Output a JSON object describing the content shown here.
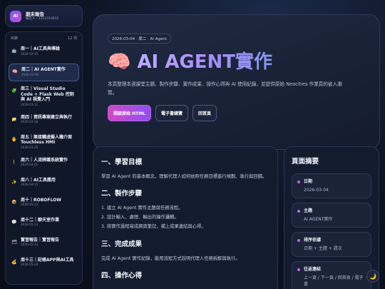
{
  "profile": {
    "avatar": "AI",
    "title": "期末報告",
    "subtitle": "報告人 · 1111310012"
  },
  "toc": {
    "label": "目錄",
    "count": "12 項",
    "items": [
      {
        "icon": "🤖",
        "title": "周一｜AI工具與導論",
        "date": "2026-02-25"
      },
      {
        "icon": "🧠",
        "title": "周二｜AI AGENT實作",
        "date": "2026-03-04"
      },
      {
        "icon": "🧩",
        "title": "周三｜Visual Studio Code + Flask Web 控制與 AI 視覺入門",
        "date": "2026-03-11"
      },
      {
        "icon": "📁",
        "title": "周四｜資訊專案建立與執行",
        "date": "2026-03-18"
      },
      {
        "icon": "🖐",
        "title": "周五｜無接觸虛擬人機介面 Touchless HMI",
        "date": "2026-03-25"
      },
      {
        "icon": "🚶",
        "title": "周六｜人流辨識系統實作",
        "date": "2026-04-01"
      },
      {
        "icon": "✨",
        "title": "周八｜AI工具應用",
        "date": "2026-04-15"
      },
      {
        "icon": "📦",
        "title": "周十｜ROBOFLOW",
        "date": "2026-05-13"
      },
      {
        "icon": "💬",
        "title": "周十二｜聊天室作業",
        "date": "2026-05-13"
      },
      {
        "icon": "🗂",
        "title": "實習報告｜實習報告",
        "date": "2026-05-13"
      },
      {
        "icon": "💰",
        "title": "周十三｜記帳APP與AI工具",
        "date": "2026-05-20"
      }
    ]
  },
  "hero": {
    "pill": "2026-03-04 · 周二 · AI Agent",
    "emoji": "🧠",
    "title": "AI AGENT實作",
    "desc": "本頁整理本週課堂主題、製作步驟、實作成果、操作心得與 AI 使用紀錄，並提供原始 Neocities 作業頁的嵌入瀏覽。",
    "buttons": {
      "primary": "開啟原始 HTML",
      "ebook": "電子書總覽",
      "home": "回首頁"
    }
  },
  "content": {
    "s1_title": "一、學習目標",
    "s1_text": "學習 AI Agent 的基本概念，理解代理人如何依照任務目標進行規劃、執行與回饋。",
    "s2_title": "二、製作步驟",
    "s2_steps": [
      "1. 建立 AI Agent 實作主題與任務流程。",
      "2. 設計輸入、處理、輸出的操作邏輯。",
      "3. 將實作過程寫成網頁筆記，補上成果連結與心得。"
    ],
    "s3_title": "三、完成成果",
    "s3_text": "完成 AI Agent 實作紀錄，能用流程方式說明代理人任務拆解與執行。",
    "s4_title": "四、操作心得"
  },
  "summary": {
    "title": "頁面摘要",
    "cards": [
      {
        "label": "日期",
        "value": "2026-03-04"
      },
      {
        "label": "主題",
        "value": "AI AGENT實作"
      },
      {
        "label": "排序依據",
        "value": "日期 + 主題 + 週次"
      },
      {
        "label": "往返連結",
        "value": "上一頁 / 下一頁 / 回首頁 / 電子書"
      }
    ]
  },
  "theme_toggle": "🌙"
}
